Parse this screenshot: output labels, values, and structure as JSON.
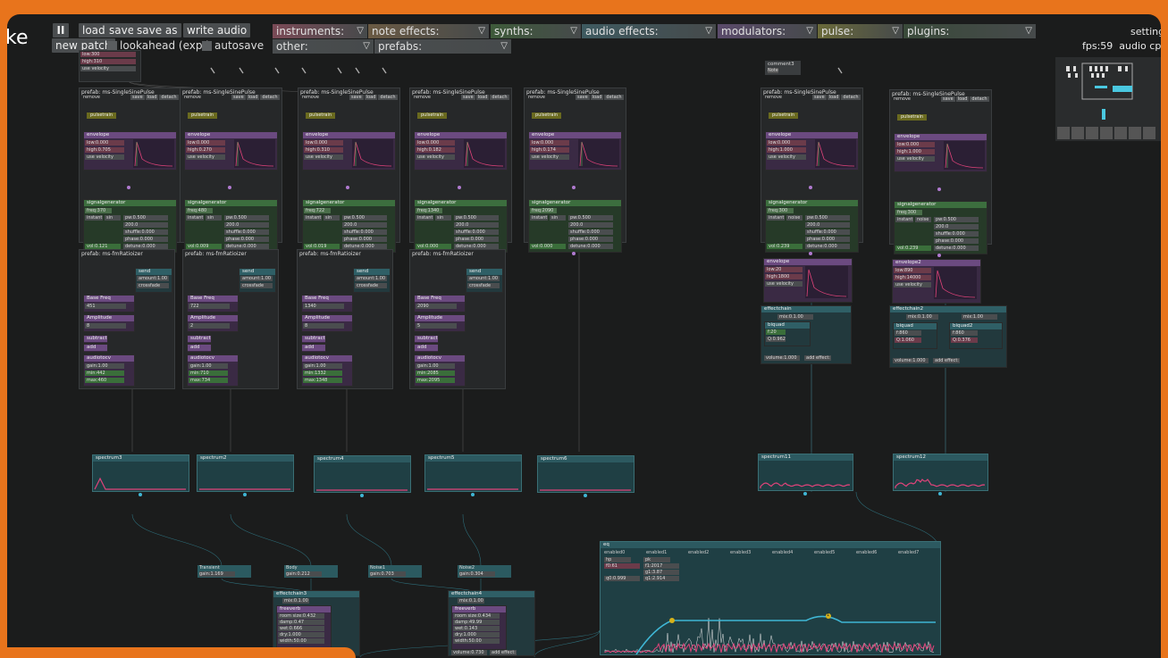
{
  "app": {
    "logo_text": "ke",
    "settings_label": "settings",
    "fps": "fps:59",
    "audio_cpu": "audio cpu"
  },
  "toolbar": {
    "pause_label": "II",
    "load": "load",
    "save": "save",
    "save_as": "save as",
    "write_audio": "write audio",
    "new_patch": "new patch",
    "lookahead": "lookahead (exp.)",
    "autosave": "autosave"
  },
  "menus": [
    {
      "label": "instruments:",
      "color": "#7a4a56"
    },
    {
      "label": "note effects:",
      "color": "#6a5a44"
    },
    {
      "label": "synths:",
      "color": "#3e5a3a"
    },
    {
      "label": "audio effects:",
      "color": "#3e5a60"
    },
    {
      "label": "modulators:",
      "color": "#5a4a6a"
    },
    {
      "label": "pulse:",
      "color": "#6a6a3a"
    },
    {
      "label": "plugins:",
      "color": "#3a4a3a"
    },
    {
      "label": "other:",
      "color": "#4a4d4f"
    },
    {
      "label": "prefabs:",
      "color": "#4a4d4f"
    }
  ],
  "top_partial": {
    "low": "low:300",
    "high": "high:310",
    "vel": "use velocity"
  },
  "comment_box": {
    "title": "comment3",
    "text": "Note"
  },
  "sinepulse": [
    {
      "title": "prefab: ms-SingleSinePulse",
      "env_low": "low:0.000",
      "env_high": "high:0.705",
      "freq": "freq:370",
      "vol": "vol:0.121",
      "wave": "sin"
    },
    {
      "title": "prefab: ms-SingleSinePulse",
      "env_low": "low:0.000",
      "env_high": "high:0.270",
      "freq": "freq:480",
      "vol": "vol:0.009",
      "wave": "sin"
    },
    {
      "title": "prefab: ms-SingleSinePulse",
      "env_low": "low:0.000",
      "env_high": "high:0.310",
      "freq": "freq:722",
      "vol": "vol:0.019",
      "wave": "sin"
    },
    {
      "title": "prefab: ms-SingleSinePulse",
      "env_low": "low:0.000",
      "env_high": "high:0.182",
      "freq": "freq:1340",
      "vol": "vol:0.000",
      "wave": "sin"
    },
    {
      "title": "prefab: ms-SingleSinePulse",
      "env_low": "low:0.000",
      "env_high": "high:0.174",
      "freq": "freq:2090",
      "vol": "vol:0.000",
      "wave": "sin"
    },
    {
      "title": "prefab: ms-SingleSinePulse",
      "env_low": "low:0.000",
      "env_high": "high:1.000",
      "freq": "freq:300",
      "vol": "vol:0.239",
      "wave": "noise"
    },
    {
      "title": "prefab: ms-SingleSinePulse",
      "env_low": "low:0.000",
      "env_high": "high:1.000",
      "freq": "freq:300",
      "vol": "vol:0.239",
      "wave": "noise"
    }
  ],
  "gen_labels": {
    "title": "signalgenerator",
    "instant": "instant",
    "pw": "pw:0.500",
    "sync": "sync",
    "sync_val": "200.0",
    "shuffle": "shuffle:0.000",
    "phase": "phase:0.000",
    "detune": "detune:0.000",
    "pulsetrain": "pulsetrain",
    "envelope": "envelope",
    "use_velocity": "use velocity",
    "remove": "remove",
    "save": "save",
    "load": "load",
    "detach": "detach"
  },
  "fm": [
    {
      "title": "prefab: ms-fmRatioizer",
      "base": "451",
      "amp": "8",
      "gain": "gain:1.00",
      "min": "min:442",
      "max": "max:460"
    },
    {
      "title": "prefab: ms-fmRatioizer",
      "base": "722",
      "amp": "2",
      "gain": "gain:1.00",
      "min": "min:710",
      "max": "max:734"
    },
    {
      "title": "prefab: ms-fmRatioizer",
      "base": "1340",
      "amp": "8",
      "gain": "gain:1.00",
      "min": "min:1332",
      "max": "max:1348"
    },
    {
      "title": "prefab: ms-fmRatioizer",
      "base": "2090",
      "amp": "5",
      "gain": "gain:1.00",
      "min": "min:2085",
      "max": "max:2095"
    }
  ],
  "fm_labels": {
    "send": "send",
    "amount": "amount:1.00",
    "crossfade": "crossfade",
    "base": "Base Freq",
    "value": "value",
    "set": "set",
    "amplitude": "Amplitude",
    "subtract": "subtract",
    "add": "add",
    "audiotocv": "audiotocv"
  },
  "env_mod": [
    {
      "title": "envelope",
      "low": "low:20",
      "high": "high:1800",
      "vel": "use velocity"
    },
    {
      "title": "envelope2",
      "low": "low:890",
      "high": "high:14000",
      "vel": "use velocity"
    }
  ],
  "effectchain": [
    {
      "title": "effectchain",
      "mix": "mix:0.1.00",
      "filter": "biquad",
      "f": "f:20",
      "q": "Q:0.962",
      "volume": "volume:1.000",
      "add": "add effect:"
    },
    {
      "title": "effectchain2",
      "mix": "mix:0.1.00",
      "mix2": "mix:1.00",
      "filter": "biquad",
      "filter2": "biquad2",
      "f": "f:860",
      "q": "Q:1.060",
      "f2": "f:860",
      "q2": "Q:0.376",
      "volume": "volume:1.000",
      "add": "add effect:"
    }
  ],
  "spectrum": [
    "spectrum3",
    "spectrum2",
    "spectrum4",
    "spectrum5",
    "spectrum6",
    "spectrum11",
    "spectrum12"
  ],
  "small_nodes": [
    {
      "title": "Transient",
      "gain": "gain:1.169"
    },
    {
      "title": "Body",
      "gain": "gain:0.212"
    },
    {
      "title": "Noise1",
      "gain": "gain:0.703"
    },
    {
      "title": "Noise2",
      "gain": "gain:0.304"
    }
  ],
  "reverb_chains": [
    {
      "title": "effectchain3",
      "mix": "mix:0.1.00",
      "fv": "freeverb",
      "room": "room size:0.432",
      "damp": "damp:0.47",
      "wet": "wet:0.666",
      "dry": "dry:1.000",
      "width": "width:50.00",
      "volume": "volume:0.775",
      "add": "add effect:"
    },
    {
      "title": "effectchain4",
      "mix": "mix:0.1.00",
      "fv": "freeverb",
      "room": "room size:0.434",
      "damp": "damp:49.99",
      "wet": "wet:0.143",
      "dry": "dry:1.000",
      "width": "width:50.00",
      "volume": "volume:0.730",
      "add": "add effect:"
    }
  ],
  "eq": {
    "title": "eq",
    "enabled": [
      "enabled0",
      "enabled1",
      "enabled2",
      "enabled3",
      "enabled4",
      "enabled5",
      "enabled6",
      "enabled7"
    ],
    "type0": "hp",
    "type1": "pk",
    "f0": "f0:61",
    "f1": "f1:2017",
    "g1": "g1:3.87",
    "q0": "q0:0.999",
    "q1": "q1:2.914",
    "point_label": "1"
  },
  "colors": {
    "accent": "#e8741c",
    "bg": "#1b1c1c",
    "pink": "#e0437a",
    "cyan": "#3fb6d4"
  }
}
